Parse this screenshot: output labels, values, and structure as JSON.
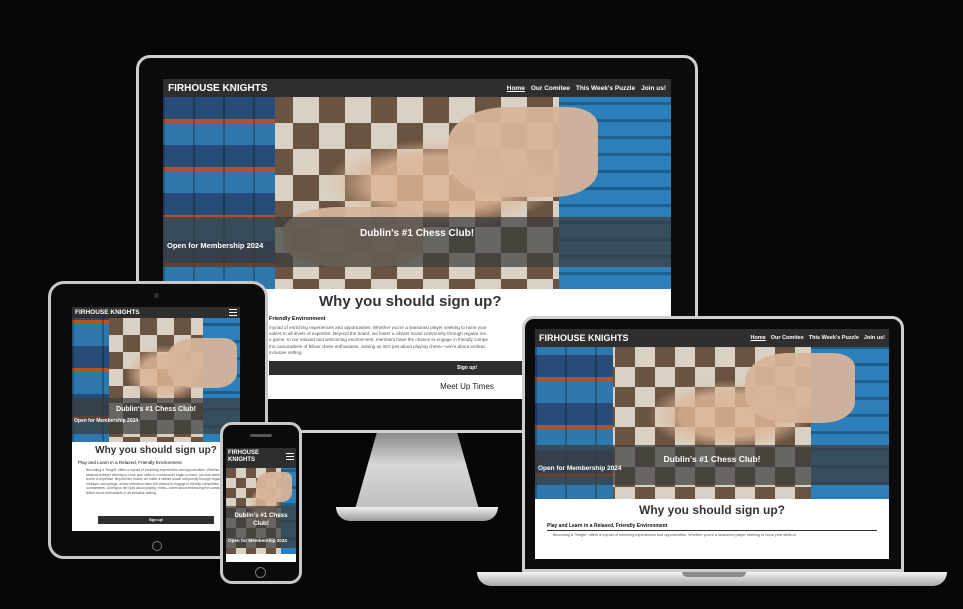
{
  "site": {
    "brand": "FIRHOUSE KNIGHTS",
    "nav": [
      "Home",
      "Our Comitee",
      "This Week's Puzzle",
      "Join us!"
    ],
    "hero_title": "Dublin's #1 Chess Club!",
    "hero_subtitle": "Open for Membership 2024",
    "why_heading": "Why you should sign up?",
    "section_heading": "Play and Learn in a Relaxed, Friendly Environment",
    "section_heading_cut": "Friendly Environment",
    "paragraph": "Becoming a \"Knight\" offers a myriad of enriching experiences and opportunities. Whether you're a seasoned player seeking to hone your skills or a newcomer eager to learn, our club caters to all levels of expertise. Beyond the board, we foster a vibrant social community through regular meetups and outings, where members have the chance to engage in friendly competition during tournaments. Joining us isn't just about playing chess—we're about embracing the camaraderie of fellow chess enthusiasts in an inclusive setting.",
    "imac_paragraph_lines": [
      "myriad of enriching experiences and opportunities. Whether you're a seasoned player seeking to hone your",
      "caters to all levels of expertise. Beyond the board, we foster a vibrant social community through regular me",
      "e game. In our relaxed and welcoming environment, members have the chance to engage in friendly compe",
      "the camaraderie of fellow chess enthusiasts. Joining us isn't just about playing chess—we're about embrac",
      "inclusive setting."
    ],
    "laptop_paragraph_line": "Becoming a \"Knight\" offers a myriad of enriching experiences and opportunities. Whether you're a seasoned player seeking to hone your skills or",
    "signup_label": "Sign up!",
    "meet_heading": "Meet Up Times"
  },
  "colors": {
    "nav_bg": "#2e2e2e",
    "page_bg": "#060606",
    "device_frame": "#cfcfcf",
    "button_bg": "#2e2e2e"
  },
  "icons": {
    "menu": "hamburger-icon",
    "home_button": "circle-button-icon"
  }
}
